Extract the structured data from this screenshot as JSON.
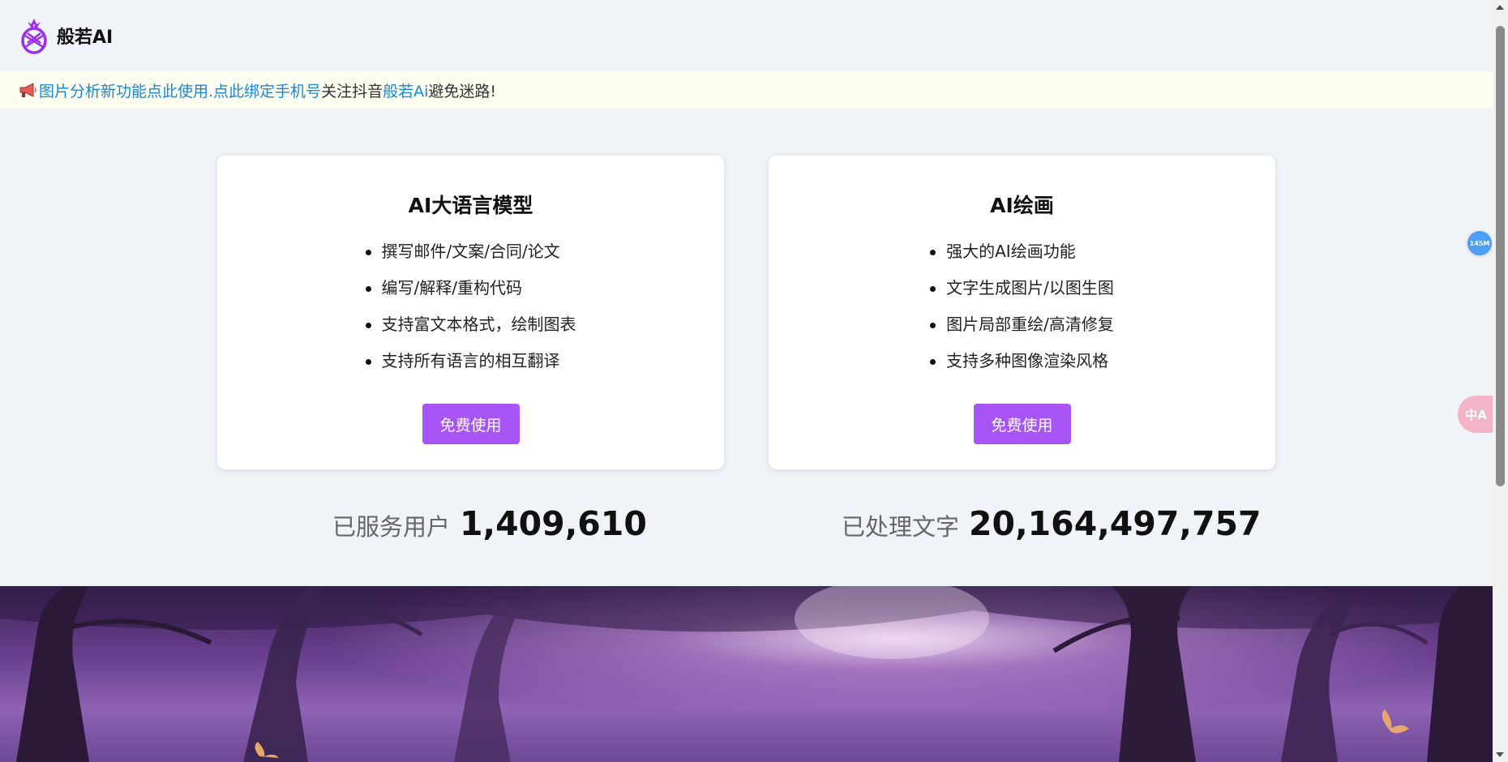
{
  "header": {
    "brand": "般若AI"
  },
  "notice": {
    "link1": "图片分析新功能点此使用.",
    "link2": " 点此绑定手机号",
    "text1": "关注抖音",
    "link3": "般若Ai",
    "text2": "避免迷路!"
  },
  "cards": [
    {
      "title": "AI大语言模型",
      "items": [
        "撰写邮件/文案/合同/论文",
        "编写/解释/重构代码",
        "支持富文本格式，绘制图表",
        "支持所有语言的相互翻译"
      ],
      "button": "免费使用"
    },
    {
      "title": "AI绘画",
      "items": [
        "强大的AI绘画功能",
        "文字生成图片/以图生图",
        "图片局部重绘/高清修复",
        "支持多种图像渲染风格"
      ],
      "button": "免费使用"
    }
  ],
  "stats": [
    {
      "label": "已服务用户",
      "value": "1,409,610"
    },
    {
      "label": "已处理文字",
      "value": "20,164,497,757"
    }
  ],
  "widgets": {
    "memory_badge": "145M",
    "translate_glyph": "中A"
  },
  "colors": {
    "accent": "#a855f7",
    "link": "#1a88d8",
    "background": "#f0f3f8",
    "notice_bg": "#fdfdf0"
  }
}
